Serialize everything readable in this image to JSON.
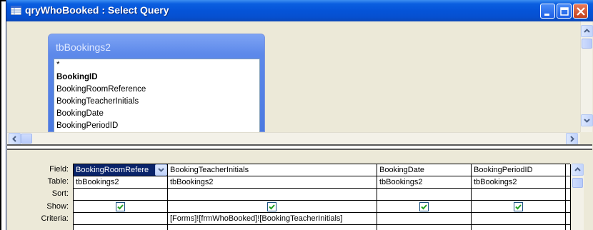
{
  "window": {
    "title": "qryWhoBooked : Select Query",
    "buttons": [
      "minimize",
      "maximize",
      "close"
    ]
  },
  "table": {
    "name": "tbBookings2",
    "fields": [
      {
        "label": "*",
        "primary_key": false
      },
      {
        "label": "BookingID",
        "primary_key": true
      },
      {
        "label": "BookingRoomReference",
        "primary_key": false
      },
      {
        "label": "BookingTeacherInitials",
        "primary_key": false
      },
      {
        "label": "BookingDate",
        "primary_key": false
      },
      {
        "label": "BookingPeriodID",
        "primary_key": false
      }
    ]
  },
  "grid": {
    "row_labels": [
      "Field:",
      "Table:",
      "Sort:",
      "Show:",
      "Criteria:"
    ],
    "columns": [
      {
        "field": "BookingRoomRefere",
        "table": "tbBookings2",
        "sort": "",
        "show": true,
        "criteria": "",
        "selected": true
      },
      {
        "field": "BookingTeacherInitials",
        "table": "tbBookings2",
        "sort": "",
        "show": true,
        "criteria": "[Forms]![frmWhoBooked]![BookingTeacherInitials]",
        "selected": false
      },
      {
        "field": "BookingDate",
        "table": "tbBookings2",
        "sort": "",
        "show": true,
        "criteria": "",
        "selected": false
      },
      {
        "field": "BookingPeriodID",
        "table": "tbBookings2",
        "sort": "",
        "show": true,
        "criteria": "",
        "selected": false
      },
      {
        "field": "",
        "table": "",
        "sort": "",
        "show": false,
        "criteria": "",
        "selected": false
      }
    ]
  },
  "colors": {
    "titlebar": "#0554d8",
    "selection": "#0a246a",
    "fieldlist_header": "#5d89ea",
    "checkbox_mark": "#21a121"
  }
}
